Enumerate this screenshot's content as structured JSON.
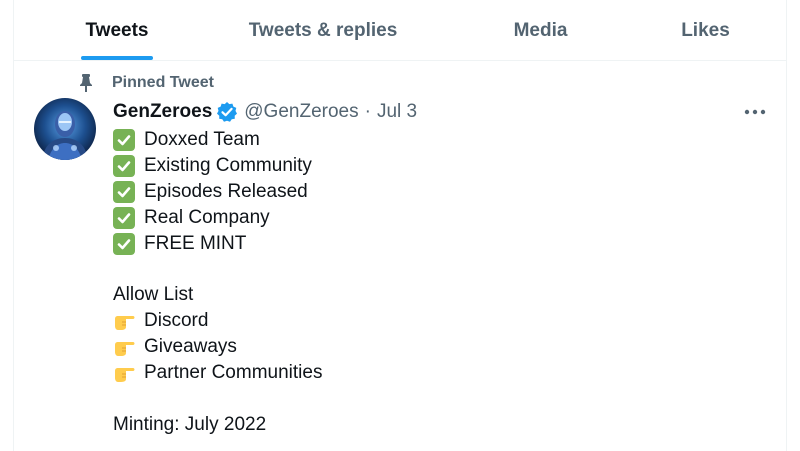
{
  "tabs": [
    {
      "label": "Tweets",
      "active": true
    },
    {
      "label": "Tweets & replies",
      "active": false
    },
    {
      "label": "Media",
      "active": false
    },
    {
      "label": "Likes",
      "active": false
    }
  ],
  "colors": {
    "accent": "#1d9bf0",
    "text_primary": "#0f1419",
    "text_secondary": "#536471",
    "check_green": "#77b255"
  },
  "tweet": {
    "pinned_label": "Pinned Tweet",
    "pin_icon": "pin-icon",
    "display_name": "GenZeroes",
    "verified_icon": "verified-badge-icon",
    "handle": "@GenZeroes",
    "separator": "·",
    "date": "Jul 3",
    "more_icon": "more-options-icon",
    "checklist": [
      "Doxxed Team",
      "Existing Community",
      "Episodes Released",
      "Real Company",
      "FREE MINT"
    ],
    "allow_list_title": "Allow List",
    "allow_list_items": [
      "Discord",
      "Giveaways",
      "Partner Communities"
    ],
    "minting_text": "Minting: July 2022"
  }
}
